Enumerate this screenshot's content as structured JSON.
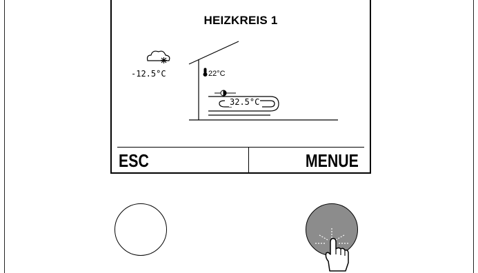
{
  "screen": {
    "title": "HEIZKREIS 1",
    "outdoor_temperature": "-12.5°C",
    "room_temperature": "22°C",
    "water_temperature": "32.5°C"
  },
  "softkeys": {
    "left_label": "ESC",
    "right_label": "MENUE"
  },
  "icons": {
    "weather": "cloud-snow-icon",
    "thermometer": "thermometer-icon",
    "sensor": "sensor-icon",
    "pointer": "tapping-hand-icon"
  },
  "colors": {
    "pressed_button": "#8c8c8c",
    "text": "#000000"
  }
}
